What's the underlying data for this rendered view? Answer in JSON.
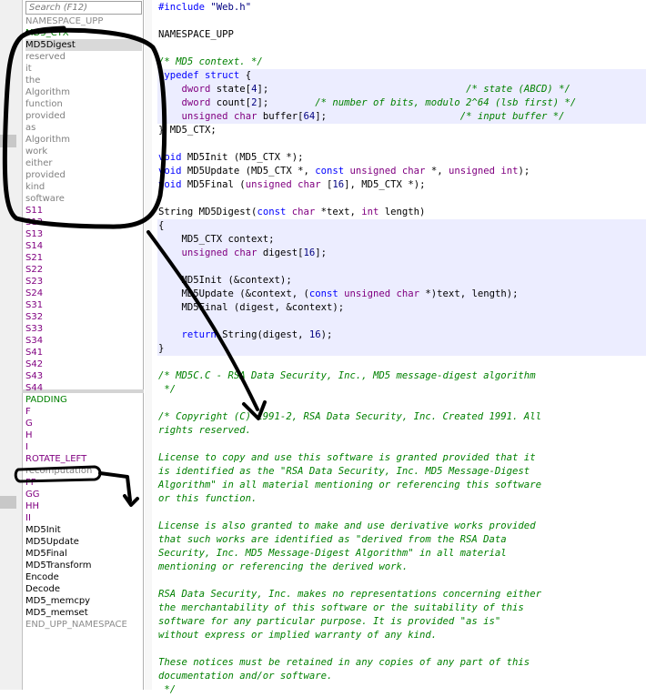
{
  "nav": {
    "search_placeholder": "Search (F12)",
    "items": [
      {
        "label": "NAMESPACE_UPP",
        "kind": "ns"
      },
      {
        "label": "MD5_CTX",
        "kind": "type"
      },
      {
        "label": "MD5Digest",
        "kind": "func"
      },
      {
        "label": "reserved",
        "kind": "var"
      },
      {
        "label": "it",
        "kind": "var"
      },
      {
        "label": "the",
        "kind": "var"
      },
      {
        "label": "Algorithm",
        "kind": "var"
      },
      {
        "label": "function",
        "kind": "var"
      },
      {
        "label": "provided",
        "kind": "var"
      },
      {
        "label": "as",
        "kind": "var"
      },
      {
        "label": "Algorithm",
        "kind": "var"
      },
      {
        "label": "work",
        "kind": "var"
      },
      {
        "label": "either",
        "kind": "var"
      },
      {
        "label": "provided",
        "kind": "var"
      },
      {
        "label": "kind",
        "kind": "var"
      },
      {
        "label": "software",
        "kind": "var"
      },
      {
        "label": "S11",
        "kind": "const"
      },
      {
        "label": "S12",
        "kind": "const"
      },
      {
        "label": "S13",
        "kind": "const"
      },
      {
        "label": "S14",
        "kind": "const"
      },
      {
        "label": "S21",
        "kind": "const"
      },
      {
        "label": "S22",
        "kind": "const"
      },
      {
        "label": "S23",
        "kind": "const"
      },
      {
        "label": "S24",
        "kind": "const"
      },
      {
        "label": "S31",
        "kind": "const"
      },
      {
        "label": "S32",
        "kind": "const"
      },
      {
        "label": "S33",
        "kind": "const"
      },
      {
        "label": "S34",
        "kind": "const"
      },
      {
        "label": "S41",
        "kind": "const"
      },
      {
        "label": "S42",
        "kind": "const"
      },
      {
        "label": "S43",
        "kind": "const"
      },
      {
        "label": "S44",
        "kind": "const"
      },
      {
        "label": "PADDING",
        "kind": "macro"
      },
      {
        "label": "F",
        "kind": "const"
      },
      {
        "label": "G",
        "kind": "const"
      },
      {
        "label": "H",
        "kind": "const"
      },
      {
        "label": "I",
        "kind": "const"
      },
      {
        "label": "ROTATE_LEFT",
        "kind": "const"
      },
      {
        "label": "recomputation",
        "kind": "var"
      },
      {
        "label": "FF",
        "kind": "const"
      },
      {
        "label": "GG",
        "kind": "const"
      },
      {
        "label": "HH",
        "kind": "const"
      },
      {
        "label": "II",
        "kind": "const"
      },
      {
        "label": "MD5Init",
        "kind": "func"
      },
      {
        "label": "MD5Update",
        "kind": "func"
      },
      {
        "label": "MD5Final",
        "kind": "func"
      },
      {
        "label": "MD5Transform",
        "kind": "func"
      },
      {
        "label": "Encode",
        "kind": "func"
      },
      {
        "label": "Decode",
        "kind": "func"
      },
      {
        "label": "MD5_memcpy",
        "kind": "func"
      },
      {
        "label": "MD5_memset",
        "kind": "func"
      },
      {
        "label": "END_UPP_NAMESPACE",
        "kind": "ns"
      }
    ],
    "selected_index": 2
  },
  "code": [
    [
      [
        "kw",
        "#include"
      ],
      [
        "pl",
        " "
      ],
      [
        "st",
        "\"Web.h\""
      ]
    ],
    [],
    [
      [
        "pl",
        "NAMESPACE_UPP"
      ]
    ],
    [],
    [
      [
        "cm",
        "/* MD5 context. */"
      ]
    ],
    [
      [
        "kw",
        "typedef"
      ],
      [
        "pl",
        " "
      ],
      [
        "kw",
        "struct"
      ],
      [
        "pl",
        " {"
      ]
    ],
    [
      [
        "pl",
        "    "
      ],
      [
        "tp",
        "dword"
      ],
      [
        "pl",
        " state["
      ],
      [
        "num",
        "4"
      ],
      [
        "pl",
        "];                                  "
      ],
      [
        "cm",
        "/* state (ABCD) */"
      ]
    ],
    [
      [
        "pl",
        "    "
      ],
      [
        "tp",
        "dword"
      ],
      [
        "pl",
        " count["
      ],
      [
        "num",
        "2"
      ],
      [
        "pl",
        "];        "
      ],
      [
        "cm",
        "/* number of bits, modulo 2^64 (lsb first) */"
      ]
    ],
    [
      [
        "pl",
        "    "
      ],
      [
        "tp",
        "unsigned"
      ],
      [
        "pl",
        " "
      ],
      [
        "tp",
        "char"
      ],
      [
        "pl",
        " buffer["
      ],
      [
        "num",
        "64"
      ],
      [
        "pl",
        "];                       "
      ],
      [
        "cm",
        "/* input buffer */"
      ]
    ],
    [
      [
        "pl",
        "} MD5_CTX;"
      ]
    ],
    [],
    [
      [
        "kw",
        "void"
      ],
      [
        "pl",
        " MD5Init (MD5_CTX *);"
      ]
    ],
    [
      [
        "kw",
        "void"
      ],
      [
        "pl",
        " MD5Update (MD5_CTX *, "
      ],
      [
        "kw",
        "const"
      ],
      [
        "pl",
        " "
      ],
      [
        "tp",
        "unsigned"
      ],
      [
        "pl",
        " "
      ],
      [
        "tp",
        "char"
      ],
      [
        "pl",
        " *, "
      ],
      [
        "tp",
        "unsigned"
      ],
      [
        "pl",
        " "
      ],
      [
        "tp",
        "int"
      ],
      [
        "pl",
        ");"
      ]
    ],
    [
      [
        "kw",
        "void"
      ],
      [
        "pl",
        " MD5Final ("
      ],
      [
        "tp",
        "unsigned"
      ],
      [
        "pl",
        " "
      ],
      [
        "tp",
        "char"
      ],
      [
        "pl",
        " ["
      ],
      [
        "num",
        "16"
      ],
      [
        "pl",
        "], MD5_CTX *);"
      ]
    ],
    [],
    [
      [
        "pl",
        "String MD5Digest("
      ],
      [
        "kw",
        "const"
      ],
      [
        "pl",
        " "
      ],
      [
        "tp",
        "char"
      ],
      [
        "pl",
        " *text, "
      ],
      [
        "tp",
        "int"
      ],
      [
        "pl",
        " length)"
      ]
    ],
    [
      [
        "pl",
        "{"
      ]
    ],
    [
      [
        "pl",
        "    MD5_CTX context;"
      ]
    ],
    [
      [
        "pl",
        "    "
      ],
      [
        "tp",
        "unsigned"
      ],
      [
        "pl",
        " "
      ],
      [
        "tp",
        "char"
      ],
      [
        "pl",
        " digest["
      ],
      [
        "num",
        "16"
      ],
      [
        "pl",
        "];"
      ]
    ],
    [],
    [
      [
        "pl",
        "    MD5Init (&context);"
      ]
    ],
    [
      [
        "pl",
        "    MD5Update (&context, ("
      ],
      [
        "kw",
        "const"
      ],
      [
        "pl",
        " "
      ],
      [
        "tp",
        "unsigned"
      ],
      [
        "pl",
        " "
      ],
      [
        "tp",
        "char"
      ],
      [
        "pl",
        " *)text, length);"
      ]
    ],
    [
      [
        "pl",
        "    MD5Final (digest, &context);"
      ]
    ],
    [],
    [
      [
        "pl",
        "    "
      ],
      [
        "kw",
        "return"
      ],
      [
        "pl",
        " String(digest, "
      ],
      [
        "num",
        "16"
      ],
      [
        "pl",
        ");"
      ]
    ],
    [
      [
        "pl",
        "}"
      ]
    ],
    [],
    [
      [
        "cm",
        "/* MD5C.C - RSA Data Security, Inc., MD5 message-digest algorithm"
      ]
    ],
    [
      [
        "cm",
        " */"
      ]
    ],
    [],
    [
      [
        "cm",
        "/* Copyright (C) 1991-2, RSA Data Security, Inc. Created 1991. All"
      ]
    ],
    [
      [
        "cm",
        "rights reserved."
      ]
    ],
    [],
    [
      [
        "cm",
        "License to copy and use this software is granted provided that it"
      ]
    ],
    [
      [
        "cm",
        "is identified as the \"RSA Data Security, Inc. MD5 Message-Digest"
      ]
    ],
    [
      [
        "cm",
        "Algorithm\" in all material mentioning or referencing this software"
      ]
    ],
    [
      [
        "cm",
        "or this function."
      ]
    ],
    [],
    [
      [
        "cm",
        "License is also granted to make and use derivative works provided"
      ]
    ],
    [
      [
        "cm",
        "that such works are identified as \"derived from the RSA Data"
      ]
    ],
    [
      [
        "cm",
        "Security, Inc. MD5 Message-Digest Algorithm\" in all material"
      ]
    ],
    [
      [
        "cm",
        "mentioning or referencing the derived work."
      ]
    ],
    [],
    [
      [
        "cm",
        "RSA Data Security, Inc. makes no representations concerning either"
      ]
    ],
    [
      [
        "cm",
        "the merchantability of this software or the suitability of this"
      ]
    ],
    [
      [
        "cm",
        "software for any particular purpose. It is provided \"as is\""
      ]
    ],
    [
      [
        "cm",
        "without express or implied warranty of any kind."
      ]
    ],
    [],
    [
      [
        "cm",
        "These notices must be retained in any copies of any part of this"
      ]
    ],
    [
      [
        "cm",
        "documentation and/or software."
      ]
    ],
    [
      [
        "cm",
        " */"
      ]
    ]
  ],
  "colors": {
    "block_bg": "#ecedff",
    "keyword": "#0000ff",
    "type": "#800080",
    "comment": "#008000",
    "annotation_ink": "#000000"
  }
}
